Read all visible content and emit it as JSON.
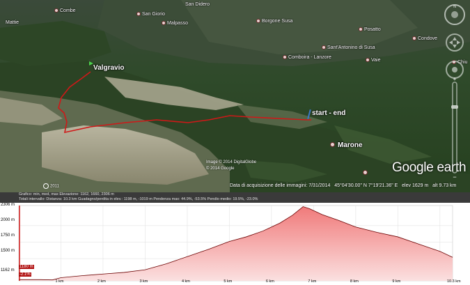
{
  "places": [
    {
      "key": "mattie",
      "label": "Mattie"
    },
    {
      "key": "combe",
      "label": "Combe"
    },
    {
      "key": "sangiorio",
      "label": "San Giorio"
    },
    {
      "key": "malpasso",
      "label": "Malpasso"
    },
    {
      "key": "sandidero",
      "label": "San Didero"
    },
    {
      "key": "borgone",
      "label": "Borgone Susa"
    },
    {
      "key": "posatto",
      "label": "Posatto"
    },
    {
      "key": "condove",
      "label": "Condove"
    },
    {
      "key": "santantonino",
      "label": "Sant'Antonino di Susa"
    },
    {
      "key": "comboira",
      "label": "Comboira - Lanzore"
    },
    {
      "key": "vaie",
      "label": "Vaie"
    },
    {
      "key": "chiu",
      "label": "Chiu"
    }
  ],
  "markers": {
    "valgravio": "Valgravio",
    "start_end": "start - end",
    "marone": "Marone"
  },
  "brand": "Google earth",
  "copyright": [
    "Image © 2014 DigitalGlobe",
    "© 2014 Google"
  ],
  "year_badge": "2011",
  "status": {
    "imagery_date": "Data di acquisizione delle immagini: 7/31/2014",
    "coords": "45°04'30.00\" N   7°19'21.36\" E",
    "elev": "elev  1629 m",
    "alt": "alt  9.73 km"
  },
  "stats": {
    "line1": "Grafico: min, med, max Elevazione: 1162, 1660, 2306 m",
    "line2": "Totali intervallo: Distanza: 10.3 km    Guadagno/perdita in elev.: 1198 m, -1019 m      Pendenza max: 44.9%, -53.5%    Pendio medio: 19.5%, -23.0%"
  },
  "chart_data": {
    "type": "area",
    "title": "",
    "xlabel": "",
    "ylabel": "",
    "y_ticks": [
      "2306 m",
      "2000 m",
      "1750 m",
      "1500 m",
      "1162 m"
    ],
    "x_ticks": [
      "1 km",
      "2 km",
      "3 km",
      "4 km",
      "5 km",
      "6 km",
      "7 km",
      "8 km",
      "9 km",
      "10.3 km"
    ],
    "ylim": [
      1162,
      2306
    ],
    "xlim": [
      0,
      10.3
    ],
    "series": [
      {
        "x": [
          0,
          0.5,
          0.8,
          1.0,
          1.5,
          2.0,
          2.5,
          3.0,
          3.5,
          4.0,
          4.5,
          5.0,
          5.4,
          5.8,
          6.2,
          6.5,
          6.75,
          6.9,
          7.2,
          7.6,
          8.0,
          8.5,
          9.0,
          9.5,
          10.0,
          10.3
        ],
        "y": [
          1180,
          1180,
          1176,
          1210,
          1240,
          1265,
          1290,
          1330,
          1420,
          1530,
          1640,
          1760,
          1830,
          1920,
          2040,
          2160,
          2290,
          2260,
          2170,
          2080,
          1980,
          1900,
          1830,
          1720,
          1610,
          1520
        ]
      }
    ],
    "current_elev_label": "1180 m",
    "current_slope_label": "-2.1%",
    "grid": true
  },
  "colors": {
    "track": "#d01818",
    "profile_fill": "#f5b8b8",
    "profile_line": "#6a0000",
    "cursor": "#d01818"
  }
}
